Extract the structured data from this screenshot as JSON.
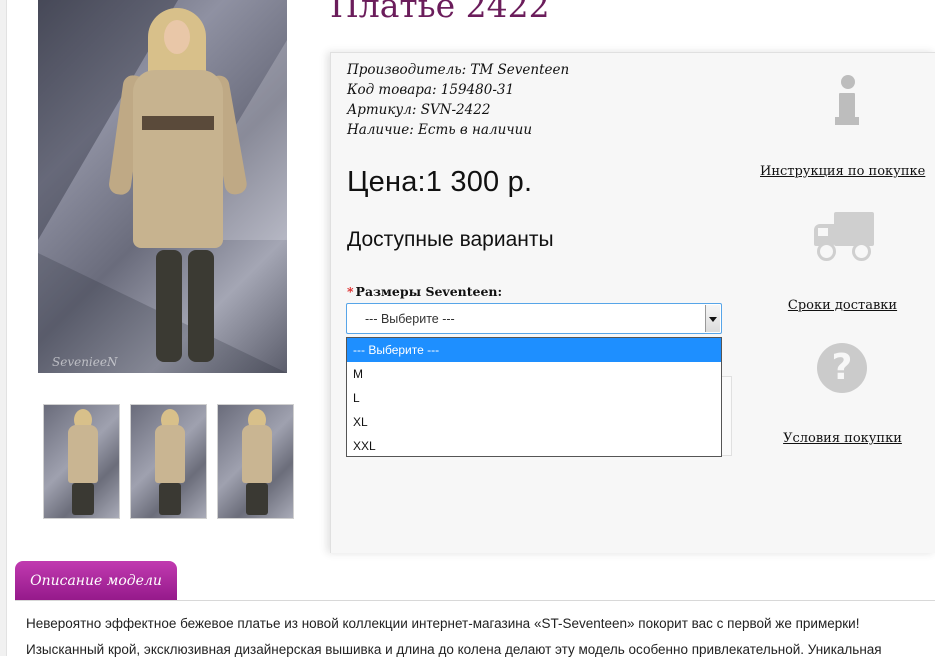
{
  "product": {
    "title": "Платье 2422",
    "meta": [
      "Производитель: ТМ Seventeen",
      "Код товара: 159480-31",
      "Артикул: SVN-2422",
      "Наличие: Есть в наличии"
    ],
    "price": "Цена:1 300 р.",
    "image_watermark": "SevenieeN"
  },
  "variants": {
    "title": "Доступные варианты",
    "required_mark": "*",
    "size_label": "Размеры Seventeen:",
    "selected": "--- Выберите ---",
    "options": [
      "--- Выберите ---",
      "M",
      "L",
      "XL",
      "XXL"
    ]
  },
  "sidebar": {
    "instructions_link": "Инструкция по покупке",
    "delivery_link": "Сроки доставки",
    "terms_link": "Условия покупки",
    "question_glyph": "?"
  },
  "icons": [
    "info-icon",
    "truck-icon",
    "question-icon"
  ],
  "colors": {
    "title": "#6b1d5b",
    "tab": "#a8209c",
    "select_highlight": "#1e8fff"
  },
  "description": {
    "tab_label": "Описание модели",
    "lines": [
      "Невероятно эффектное бежевое платье из новой коллекции интернет-магазина «ST-Seventeen» покорит вас с первой же примерки!",
      "Изысканный крой, эксклюзивная дизайнерская вышивка и длина до колена делают эту модель особенно привлекательной. Уникальная"
    ]
  }
}
